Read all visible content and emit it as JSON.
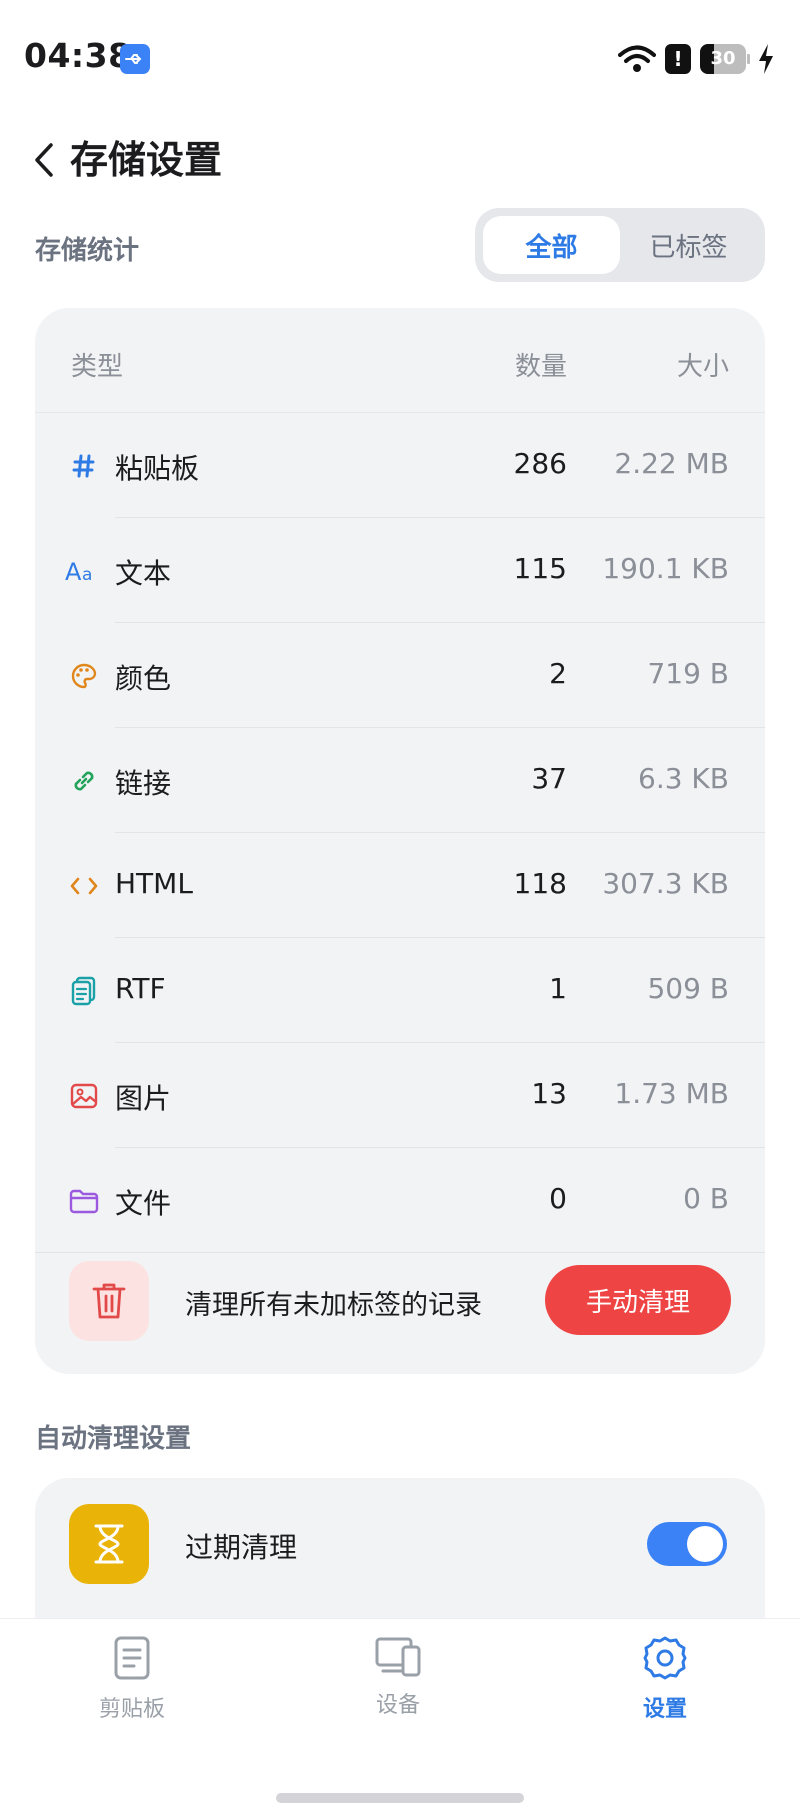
{
  "status_bar": {
    "time": "04:38",
    "battery": "30",
    "battery_level": 0.3
  },
  "header": {
    "title": "存储设置"
  },
  "stats": {
    "section_label": "存储统计",
    "segments": [
      {
        "label": "全部",
        "active": true
      },
      {
        "label": "已标签",
        "active": false
      }
    ],
    "columns": {
      "type": "类型",
      "count": "数量",
      "size": "大小"
    },
    "rows": [
      {
        "label": "粘贴板",
        "count": "286",
        "size": "2.22 MB",
        "icon": "hash-icon",
        "color": "#2f7be6"
      },
      {
        "label": "文本",
        "count": "115",
        "size": "190.1 KB",
        "icon": "text-icon",
        "color": "#2f7be6"
      },
      {
        "label": "颜色",
        "count": "2",
        "size": "719 B",
        "icon": "palette-icon",
        "color": "#e0871c"
      },
      {
        "label": "链接",
        "count": "37",
        "size": "6.3 KB",
        "icon": "link-icon",
        "color": "#22a35a"
      },
      {
        "label": "HTML",
        "count": "118",
        "size": "307.3 KB",
        "icon": "code-icon",
        "color": "#e0871c"
      },
      {
        "label": "RTF",
        "count": "1",
        "size": "509 B",
        "icon": "document-icon",
        "color": "#1aa1a8"
      },
      {
        "label": "图片",
        "count": "13",
        "size": "1.73 MB",
        "icon": "image-icon",
        "color": "#e24a4a"
      },
      {
        "label": "文件",
        "count": "0",
        "size": "0 B",
        "icon": "folder-icon",
        "color": "#9b59e0"
      }
    ],
    "cleanup": {
      "text": "清理所有未加标签的记录",
      "button": "手动清理"
    }
  },
  "auto_clean": {
    "section_label": "自动清理设置",
    "item_label": "过期清理",
    "enabled": true
  },
  "nav": [
    {
      "label": "剪贴板",
      "icon": "clipboard-icon",
      "active": false
    },
    {
      "label": "设备",
      "icon": "devices-icon",
      "active": false
    },
    {
      "label": "设置",
      "icon": "gear-icon",
      "active": true
    }
  ],
  "colors": {
    "accent": "#2f7be6",
    "danger": "#ef4444",
    "warning": "#eab308"
  }
}
